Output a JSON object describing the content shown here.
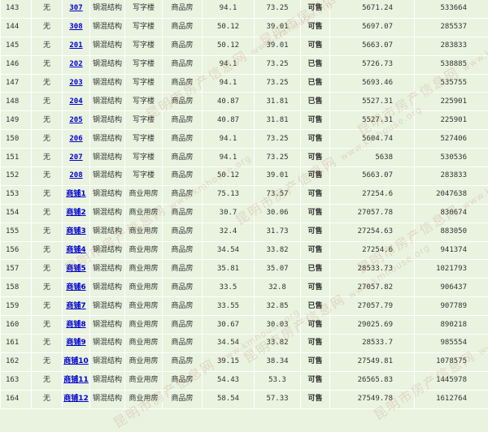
{
  "watermark": {
    "text": "昆明市房产信息网",
    "url": "www.kmhouse.org"
  },
  "status_colors": {
    "available": "#1a7a1a",
    "sold": "#cc0000"
  },
  "rows": [
    {
      "no": "143",
      "mortgage": "无",
      "room": "307",
      "structure": "钢混结构",
      "use": "写字楼",
      "type": "商品房",
      "area_built": "94.1",
      "area_inner": "73.25",
      "status": "可售",
      "price": "5671.24",
      "total": "533664"
    },
    {
      "no": "144",
      "mortgage": "无",
      "room": "308",
      "structure": "钢混结构",
      "use": "写字楼",
      "type": "商品房",
      "area_built": "50.12",
      "area_inner": "39.01",
      "status": "可售",
      "price": "5697.07",
      "total": "285537"
    },
    {
      "no": "145",
      "mortgage": "无",
      "room": "201",
      "structure": "钢混结构",
      "use": "写字楼",
      "type": "商品房",
      "area_built": "50.12",
      "area_inner": "39.01",
      "status": "可售",
      "price": "5663.07",
      "total": "283833"
    },
    {
      "no": "146",
      "mortgage": "无",
      "room": "202",
      "structure": "钢混结构",
      "use": "写字楼",
      "type": "商品房",
      "area_built": "94.1",
      "area_inner": "73.25",
      "status": "已售",
      "price": "5726.73",
      "total": "538885"
    },
    {
      "no": "147",
      "mortgage": "无",
      "room": "203",
      "structure": "钢混结构",
      "use": "写字楼",
      "type": "商品房",
      "area_built": "94.1",
      "area_inner": "73.25",
      "status": "已售",
      "price": "5693.46",
      "total": "535755"
    },
    {
      "no": "148",
      "mortgage": "无",
      "room": "204",
      "structure": "钢混结构",
      "use": "写字楼",
      "type": "商品房",
      "area_built": "40.87",
      "area_inner": "31.81",
      "status": "已售",
      "price": "5527.31",
      "total": "225901"
    },
    {
      "no": "149",
      "mortgage": "无",
      "room": "205",
      "structure": "钢混结构",
      "use": "写字楼",
      "type": "商品房",
      "area_built": "40.87",
      "area_inner": "31.81",
      "status": "可售",
      "price": "5527.31",
      "total": "225901"
    },
    {
      "no": "150",
      "mortgage": "无",
      "room": "206",
      "structure": "钢混结构",
      "use": "写字楼",
      "type": "商品房",
      "area_built": "94.1",
      "area_inner": "73.25",
      "status": "可售",
      "price": "5604.74",
      "total": "527406"
    },
    {
      "no": "151",
      "mortgage": "无",
      "room": "207",
      "structure": "钢混结构",
      "use": "写字楼",
      "type": "商品房",
      "area_built": "94.1",
      "area_inner": "73.25",
      "status": "可售",
      "price": "5638",
      "total": "530536"
    },
    {
      "no": "152",
      "mortgage": "无",
      "room": "208",
      "structure": "钢混结构",
      "use": "写字楼",
      "type": "商品房",
      "area_built": "50.12",
      "area_inner": "39.01",
      "status": "可售",
      "price": "5663.07",
      "total": "283833"
    },
    {
      "no": "153",
      "mortgage": "无",
      "room": "商铺1",
      "structure": "钢混结构",
      "use": "商业用房",
      "type": "商品房",
      "area_built": "75.13",
      "area_inner": "73.57",
      "status": "可售",
      "price": "27254.6",
      "total": "2047638"
    },
    {
      "no": "154",
      "mortgage": "无",
      "room": "商铺2",
      "structure": "钢混结构",
      "use": "商业用房",
      "type": "商品房",
      "area_built": "30.7",
      "area_inner": "30.06",
      "status": "可售",
      "price": "27057.78",
      "total": "830674"
    },
    {
      "no": "155",
      "mortgage": "无",
      "room": "商铺3",
      "structure": "钢混结构",
      "use": "商业用房",
      "type": "商品房",
      "area_built": "32.4",
      "area_inner": "31.73",
      "status": "可售",
      "price": "27254.63",
      "total": "883050"
    },
    {
      "no": "156",
      "mortgage": "无",
      "room": "商铺4",
      "structure": "钢混结构",
      "use": "商业用房",
      "type": "商品房",
      "area_built": "34.54",
      "area_inner": "33.82",
      "status": "可售",
      "price": "27254.6",
      "total": "941374"
    },
    {
      "no": "157",
      "mortgage": "无",
      "room": "商铺5",
      "structure": "钢混结构",
      "use": "商业用房",
      "type": "商品房",
      "area_built": "35.81",
      "area_inner": "35.07",
      "status": "已售",
      "price": "28533.73",
      "total": "1021793"
    },
    {
      "no": "158",
      "mortgage": "无",
      "room": "商铺6",
      "structure": "钢混结构",
      "use": "商业用房",
      "type": "商品房",
      "area_built": "33.5",
      "area_inner": "32.8",
      "status": "可售",
      "price": "27057.82",
      "total": "906437"
    },
    {
      "no": "159",
      "mortgage": "无",
      "room": "商铺7",
      "structure": "钢混结构",
      "use": "商业用房",
      "type": "商品房",
      "area_built": "33.55",
      "area_inner": "32.85",
      "status": "已售",
      "price": "27057.79",
      "total": "907789"
    },
    {
      "no": "160",
      "mortgage": "无",
      "room": "商铺8",
      "structure": "钢混结构",
      "use": "商业用房",
      "type": "商品房",
      "area_built": "30.67",
      "area_inner": "30.03",
      "status": "可售",
      "price": "29025.69",
      "total": "890218"
    },
    {
      "no": "161",
      "mortgage": "无",
      "room": "商铺9",
      "structure": "钢混结构",
      "use": "商业用房",
      "type": "商品房",
      "area_built": "34.54",
      "area_inner": "33.82",
      "status": "可售",
      "price": "28533.7",
      "total": "985554"
    },
    {
      "no": "162",
      "mortgage": "无",
      "room": "商铺10",
      "structure": "钢混结构",
      "use": "商业用房",
      "type": "商品房",
      "area_built": "39.15",
      "area_inner": "38.34",
      "status": "可售",
      "price": "27549.81",
      "total": "1078575"
    },
    {
      "no": "163",
      "mortgage": "无",
      "room": "商铺11",
      "structure": "钢混结构",
      "use": "商业用房",
      "type": "商品房",
      "area_built": "54.43",
      "area_inner": "53.3",
      "status": "可售",
      "price": "26565.83",
      "total": "1445978"
    },
    {
      "no": "164",
      "mortgage": "无",
      "room": "商铺12",
      "structure": "钢混结构",
      "use": "商业用房",
      "type": "商品房",
      "area_built": "58.54",
      "area_inner": "57.33",
      "status": "可售",
      "price": "27549.78",
      "total": "1612764"
    }
  ]
}
